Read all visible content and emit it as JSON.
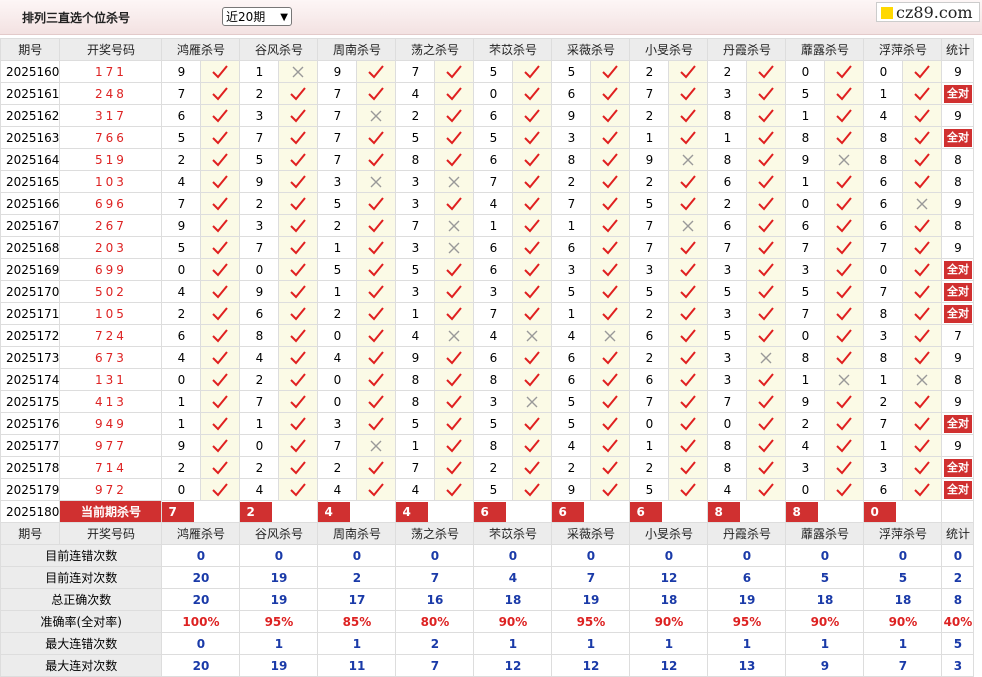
{
  "header": {
    "title": "排列三直选个位杀号",
    "range_select": "近20期",
    "logo": "cz89.com"
  },
  "columns": {
    "period": "期号",
    "draw": "开奖号码",
    "experts": [
      "鸿雁杀号",
      "谷风杀号",
      "周南杀号",
      "荡之杀号",
      "芣苡杀号",
      "采薇杀号",
      "小旻杀号",
      "丹霞杀号",
      "蘼露杀号",
      "浮萍杀号"
    ],
    "stat": "统计"
  },
  "full_label": "全对",
  "rows": [
    {
      "period": "2025160",
      "draw": "171",
      "kills": [
        [
          9,
          1
        ],
        [
          1,
          0
        ],
        [
          9,
          1
        ],
        [
          7,
          1
        ],
        [
          5,
          1
        ],
        [
          5,
          1
        ],
        [
          2,
          1
        ],
        [
          2,
          1
        ],
        [
          0,
          1
        ],
        [
          0,
          1
        ]
      ],
      "stat": "9"
    },
    {
      "period": "2025161",
      "draw": "248",
      "kills": [
        [
          7,
          1
        ],
        [
          2,
          1
        ],
        [
          7,
          1
        ],
        [
          4,
          1
        ],
        [
          0,
          1
        ],
        [
          6,
          1
        ],
        [
          7,
          1
        ],
        [
          3,
          1
        ],
        [
          5,
          1
        ],
        [
          1,
          1
        ]
      ],
      "stat": "全对"
    },
    {
      "period": "2025162",
      "draw": "317",
      "kills": [
        [
          6,
          1
        ],
        [
          3,
          1
        ],
        [
          7,
          0
        ],
        [
          2,
          1
        ],
        [
          6,
          1
        ],
        [
          9,
          1
        ],
        [
          2,
          1
        ],
        [
          8,
          1
        ],
        [
          1,
          1
        ],
        [
          4,
          1
        ]
      ],
      "stat": "9"
    },
    {
      "period": "2025163",
      "draw": "766",
      "kills": [
        [
          5,
          1
        ],
        [
          7,
          1
        ],
        [
          7,
          1
        ],
        [
          5,
          1
        ],
        [
          5,
          1
        ],
        [
          3,
          1
        ],
        [
          1,
          1
        ],
        [
          1,
          1
        ],
        [
          8,
          1
        ],
        [
          8,
          1
        ]
      ],
      "stat": "全对"
    },
    {
      "period": "2025164",
      "draw": "519",
      "kills": [
        [
          2,
          1
        ],
        [
          5,
          1
        ],
        [
          7,
          1
        ],
        [
          8,
          1
        ],
        [
          6,
          1
        ],
        [
          8,
          1
        ],
        [
          9,
          0
        ],
        [
          8,
          1
        ],
        [
          9,
          0
        ],
        [
          8,
          1
        ]
      ],
      "stat": "8"
    },
    {
      "period": "2025165",
      "draw": "103",
      "kills": [
        [
          4,
          1
        ],
        [
          9,
          1
        ],
        [
          3,
          0
        ],
        [
          3,
          0
        ],
        [
          7,
          1
        ],
        [
          2,
          1
        ],
        [
          2,
          1
        ],
        [
          6,
          1
        ],
        [
          1,
          1
        ],
        [
          6,
          1
        ]
      ],
      "stat": "8"
    },
    {
      "period": "2025166",
      "draw": "696",
      "kills": [
        [
          7,
          1
        ],
        [
          2,
          1
        ],
        [
          5,
          1
        ],
        [
          3,
          1
        ],
        [
          4,
          1
        ],
        [
          7,
          1
        ],
        [
          5,
          1
        ],
        [
          2,
          1
        ],
        [
          0,
          1
        ],
        [
          6,
          0
        ]
      ],
      "stat": "9"
    },
    {
      "period": "2025167",
      "draw": "267",
      "kills": [
        [
          9,
          1
        ],
        [
          3,
          1
        ],
        [
          2,
          1
        ],
        [
          7,
          0
        ],
        [
          1,
          1
        ],
        [
          1,
          1
        ],
        [
          7,
          0
        ],
        [
          6,
          1
        ],
        [
          6,
          1
        ],
        [
          6,
          1
        ]
      ],
      "stat": "8"
    },
    {
      "period": "2025168",
      "draw": "203",
      "kills": [
        [
          5,
          1
        ],
        [
          7,
          1
        ],
        [
          1,
          1
        ],
        [
          3,
          0
        ],
        [
          6,
          1
        ],
        [
          6,
          1
        ],
        [
          7,
          1
        ],
        [
          7,
          1
        ],
        [
          7,
          1
        ],
        [
          7,
          1
        ]
      ],
      "stat": "9"
    },
    {
      "period": "2025169",
      "draw": "699",
      "kills": [
        [
          0,
          1
        ],
        [
          0,
          1
        ],
        [
          5,
          1
        ],
        [
          5,
          1
        ],
        [
          6,
          1
        ],
        [
          3,
          1
        ],
        [
          3,
          1
        ],
        [
          3,
          1
        ],
        [
          3,
          1
        ],
        [
          0,
          1
        ]
      ],
      "stat": "全对"
    },
    {
      "period": "2025170",
      "draw": "502",
      "kills": [
        [
          4,
          1
        ],
        [
          9,
          1
        ],
        [
          1,
          1
        ],
        [
          3,
          1
        ],
        [
          3,
          1
        ],
        [
          5,
          1
        ],
        [
          5,
          1
        ],
        [
          5,
          1
        ],
        [
          5,
          1
        ],
        [
          7,
          1
        ]
      ],
      "stat": "全对"
    },
    {
      "period": "2025171",
      "draw": "105",
      "kills": [
        [
          2,
          1
        ],
        [
          6,
          1
        ],
        [
          2,
          1
        ],
        [
          1,
          1
        ],
        [
          7,
          1
        ],
        [
          1,
          1
        ],
        [
          2,
          1
        ],
        [
          3,
          1
        ],
        [
          7,
          1
        ],
        [
          8,
          1
        ]
      ],
      "stat": "全对"
    },
    {
      "period": "2025172",
      "draw": "724",
      "kills": [
        [
          6,
          1
        ],
        [
          8,
          1
        ],
        [
          0,
          1
        ],
        [
          4,
          0
        ],
        [
          4,
          0
        ],
        [
          4,
          0
        ],
        [
          6,
          1
        ],
        [
          5,
          1
        ],
        [
          0,
          1
        ],
        [
          3,
          1
        ]
      ],
      "stat": "7"
    },
    {
      "period": "2025173",
      "draw": "673",
      "kills": [
        [
          4,
          1
        ],
        [
          4,
          1
        ],
        [
          4,
          1
        ],
        [
          9,
          1
        ],
        [
          6,
          1
        ],
        [
          6,
          1
        ],
        [
          2,
          1
        ],
        [
          3,
          0
        ],
        [
          8,
          1
        ],
        [
          8,
          1
        ]
      ],
      "stat": "9"
    },
    {
      "period": "2025174",
      "draw": "131",
      "kills": [
        [
          0,
          1
        ],
        [
          2,
          1
        ],
        [
          0,
          1
        ],
        [
          8,
          1
        ],
        [
          8,
          1
        ],
        [
          6,
          1
        ],
        [
          6,
          1
        ],
        [
          3,
          1
        ],
        [
          1,
          0
        ],
        [
          1,
          0
        ]
      ],
      "stat": "8"
    },
    {
      "period": "2025175",
      "draw": "413",
      "kills": [
        [
          1,
          1
        ],
        [
          7,
          1
        ],
        [
          0,
          1
        ],
        [
          8,
          1
        ],
        [
          3,
          0
        ],
        [
          5,
          1
        ],
        [
          7,
          1
        ],
        [
          7,
          1
        ],
        [
          9,
          1
        ],
        [
          2,
          1
        ]
      ],
      "stat": "9"
    },
    {
      "period": "2025176",
      "draw": "949",
      "kills": [
        [
          1,
          1
        ],
        [
          1,
          1
        ],
        [
          3,
          1
        ],
        [
          5,
          1
        ],
        [
          5,
          1
        ],
        [
          5,
          1
        ],
        [
          0,
          1
        ],
        [
          0,
          1
        ],
        [
          2,
          1
        ],
        [
          7,
          1
        ]
      ],
      "stat": "全对"
    },
    {
      "period": "2025177",
      "draw": "977",
      "kills": [
        [
          9,
          1
        ],
        [
          0,
          1
        ],
        [
          7,
          0
        ],
        [
          1,
          1
        ],
        [
          8,
          1
        ],
        [
          4,
          1
        ],
        [
          1,
          1
        ],
        [
          8,
          1
        ],
        [
          4,
          1
        ],
        [
          1,
          1
        ]
      ],
      "stat": "9"
    },
    {
      "period": "2025178",
      "draw": "714",
      "kills": [
        [
          2,
          1
        ],
        [
          2,
          1
        ],
        [
          2,
          1
        ],
        [
          7,
          1
        ],
        [
          2,
          1
        ],
        [
          2,
          1
        ],
        [
          2,
          1
        ],
        [
          8,
          1
        ],
        [
          3,
          1
        ],
        [
          3,
          1
        ]
      ],
      "stat": "全对"
    },
    {
      "period": "2025179",
      "draw": "972",
      "kills": [
        [
          0,
          1
        ],
        [
          4,
          1
        ],
        [
          4,
          1
        ],
        [
          4,
          1
        ],
        [
          5,
          1
        ],
        [
          9,
          1
        ],
        [
          5,
          1
        ],
        [
          4,
          1
        ],
        [
          0,
          1
        ],
        [
          6,
          1
        ]
      ],
      "stat": "全对"
    }
  ],
  "current": {
    "period": "2025180",
    "label": "当前期杀号",
    "kills": [
      "7",
      "2",
      "4",
      "4",
      "6",
      "6",
      "6",
      "8",
      "8",
      "0"
    ]
  },
  "summary": [
    {
      "label": "目前连错次数",
      "values": [
        "0",
        "0",
        "0",
        "0",
        "0",
        "0",
        "0",
        "0",
        "0",
        "0"
      ],
      "stat": "0"
    },
    {
      "label": "目前连对次数",
      "values": [
        "20",
        "19",
        "2",
        "7",
        "4",
        "7",
        "12",
        "6",
        "5",
        "5"
      ],
      "stat": "2"
    },
    {
      "label": "总正确次数",
      "values": [
        "20",
        "19",
        "17",
        "16",
        "18",
        "19",
        "18",
        "19",
        "18",
        "18"
      ],
      "stat": "8"
    },
    {
      "label": "准确率(全对率)",
      "values": [
        "100%",
        "95%",
        "85%",
        "80%",
        "90%",
        "95%",
        "90%",
        "95%",
        "90%",
        "90%"
      ],
      "stat": "40%",
      "pct": true
    },
    {
      "label": "最大连错次数",
      "values": [
        "0",
        "1",
        "1",
        "2",
        "1",
        "1",
        "1",
        "1",
        "1",
        "1"
      ],
      "stat": "5"
    },
    {
      "label": "最大连对次数",
      "values": [
        "20",
        "19",
        "11",
        "7",
        "12",
        "12",
        "12",
        "13",
        "9",
        "7"
      ],
      "stat": "3"
    }
  ],
  "colors": {
    "accent_red": "#d03030",
    "check_red": "#e02020",
    "cross_gray": "#999999",
    "summary_blue": "#1a3aa8"
  }
}
